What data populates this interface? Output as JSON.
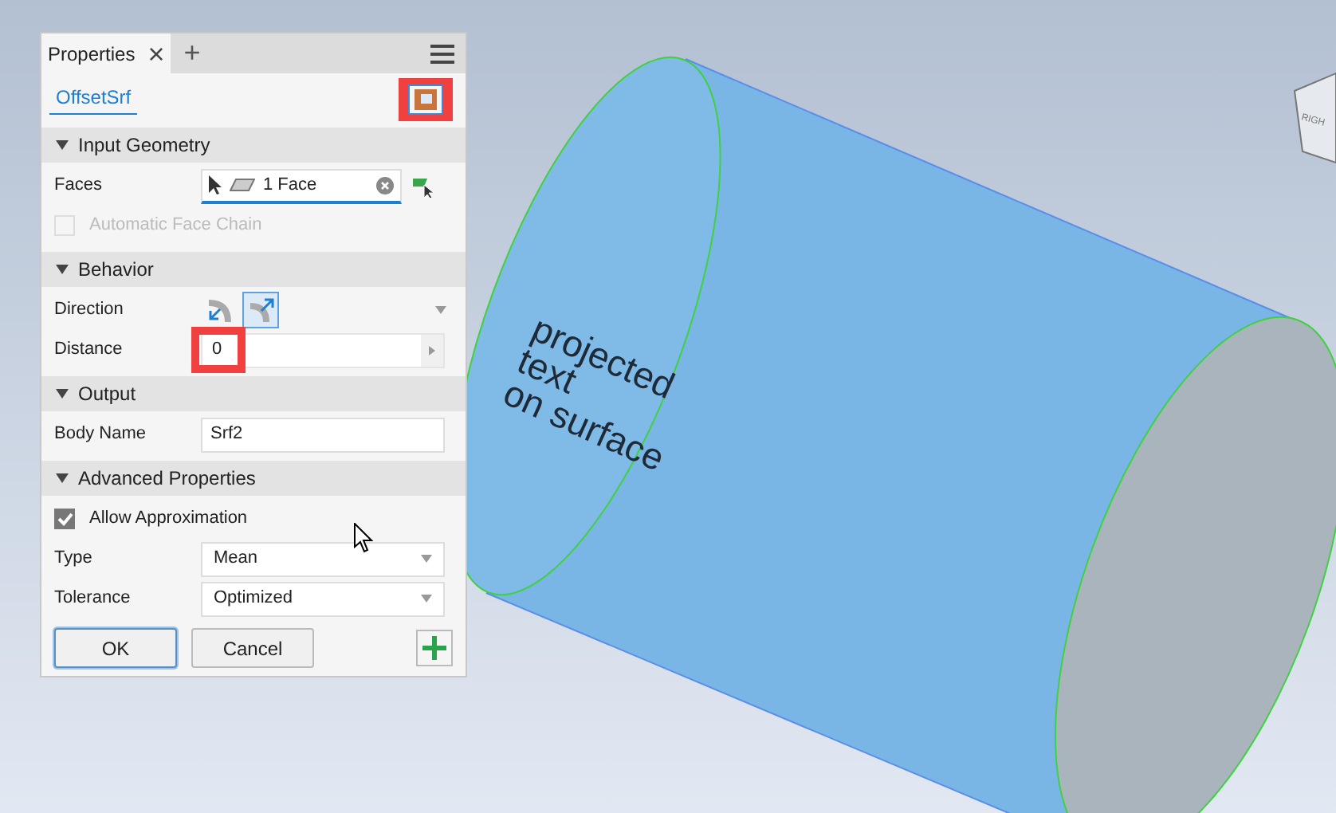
{
  "panel": {
    "tabs": [
      {
        "label": "Properties",
        "selected": true,
        "close": "×"
      },
      {
        "label": "+",
        "selected": false
      }
    ],
    "feature_name": "OffsetSrf",
    "sections": [
      {
        "title": "Input Geometry",
        "expanded": true,
        "rows": [
          {
            "kind": "select",
            "label": "Faces",
            "value": "1 Face"
          },
          {
            "kind": "checkbox",
            "label": "Automatic Face Chain",
            "checked": false,
            "disabled": true
          }
        ]
      },
      {
        "title": "Behavior",
        "expanded": true,
        "rows": [
          {
            "kind": "direction",
            "label": "Direction",
            "options": [
              {
                "selected": false
              },
              {
                "selected": true
              }
            ]
          },
          {
            "kind": "number",
            "label": "Distance",
            "value": "0",
            "highlighted": true
          }
        ]
      },
      {
        "title": "Output",
        "expanded": true,
        "rows": [
          {
            "kind": "text",
            "label": "Body Name",
            "value": "Srf2"
          }
        ]
      },
      {
        "title": "Advanced Properties",
        "expanded": true,
        "rows": [
          {
            "kind": "checkbox",
            "label": "Allow Approximation",
            "checked": true,
            "disabled": false
          },
          {
            "kind": "dropdown",
            "label": "Type",
            "value": "Mean"
          },
          {
            "kind": "dropdown",
            "label": "Tolerance",
            "value": "Optimized"
          }
        ]
      }
    ],
    "buttons": [
      "OK",
      "Cancel"
    ]
  },
  "viewport": {
    "surface_text": [
      "projected",
      "text",
      "on surface"
    ],
    "view_cube_label": "RIGH"
  }
}
